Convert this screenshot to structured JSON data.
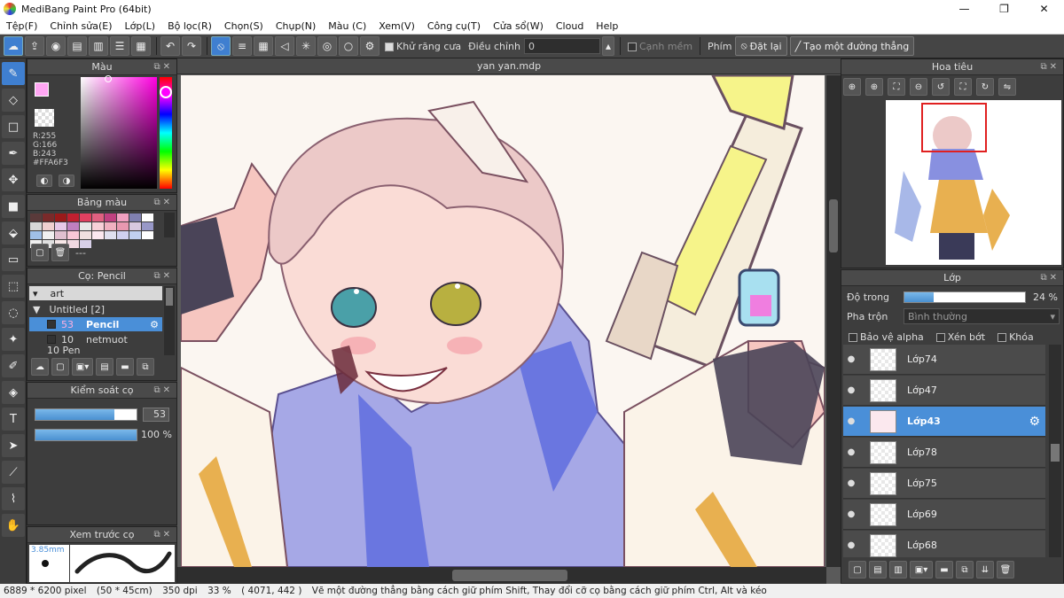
{
  "window": {
    "title": "MediBang Paint Pro (64bit)",
    "min": "—",
    "max": "❐",
    "close": "✕"
  },
  "menu": [
    "Tệp(F)",
    "Chỉnh sửa(E)",
    "Lớp(L)",
    "Bộ lọc(R)",
    "Chọn(S)",
    "Chụp(N)",
    "Màu (C)",
    "Xem(V)",
    "Công cụ(T)",
    "Cửa sổ(W)",
    "Cloud",
    "Help"
  ],
  "toolbar": {
    "antialias_label": "Khử răng cưa",
    "adjust_label": "Điều chỉnh",
    "adjust_value": "0",
    "soften_label": "Cạnh mềm",
    "key_label": "Phím",
    "reset_label": "Đặt lại",
    "straight_label": "Tạo một đường thẳng"
  },
  "color_panel": {
    "title": "Màu",
    "r": "R:255",
    "g": "G:166",
    "b": "B:243",
    "hex": "#FFA6F3",
    "current_color": "#FFA6F3"
  },
  "palette_panel": {
    "title": "Bảng màu",
    "name": "---",
    "swatches": [
      "#5a3a3a",
      "#7a2a2a",
      "#9a1a1a",
      "#c02030",
      "#e04060",
      "#e06080",
      "#c04080",
      "#f0a0c0",
      "#8080b0",
      "#ffffff",
      "#d8d8d8",
      "#f0d0d0",
      "#e8c8e8",
      "#c080c0",
      "#e8e8e8",
      "#f8d0d8",
      "#f0b0c0",
      "#e898b0",
      "#d8c8e0",
      "#9898c8",
      "#a0c0e8",
      "#f0f0f0",
      "#e0c0d0",
      "#f8c8d8",
      "#f0e0e0",
      "#fce8f0",
      "#e0e0f0",
      "#d0d0f0",
      "#c0d0f0",
      "#ffffff",
      "#f0f0f0",
      "#e0e0e0",
      "#f8e8e8",
      "#f0d8e0",
      "#d8d0e8"
    ]
  },
  "brush_panel": {
    "title": "Cọ: Pencil",
    "group_art": "art",
    "group_untitled": "Untitled [2]",
    "items": [
      {
        "size": "53",
        "name": "Pencil"
      },
      {
        "size": "10",
        "name": "netmuot"
      }
    ],
    "partial": "10 Pen"
  },
  "brush_control": {
    "title": "Kiểm soát cọ",
    "size": "53",
    "opacity": "100 %",
    "size_fill": 0.78,
    "opacity_fill": 1.0
  },
  "brush_preview": {
    "title": "Xem trước cọ",
    "size": "3.85mm"
  },
  "canvas": {
    "doc_title": "yan yan.mdp"
  },
  "navigator": {
    "title": "Hoa tiêu"
  },
  "layer_panel": {
    "title": "Lớp",
    "opacity_label": "Độ trong",
    "opacity_value": "24 %",
    "opacity_fill": 0.24,
    "blend_label": "Pha trộn",
    "blend_value": "Bình thường",
    "protect_alpha": "Bảo vệ alpha",
    "clip": "Xén bớt",
    "lock": "Khóa",
    "layers": [
      {
        "name": "Lớp74",
        "selected": false
      },
      {
        "name": "Lớp47",
        "selected": false
      },
      {
        "name": "Lớp43",
        "selected": true
      },
      {
        "name": "Lớp78",
        "selected": false
      },
      {
        "name": "Lớp75",
        "selected": false
      },
      {
        "name": "Lớp69",
        "selected": false
      },
      {
        "name": "Lớp68",
        "selected": false
      }
    ]
  },
  "status": {
    "pixels": "6889 * 6200 pixel",
    "cm": "(50 * 45cm)",
    "dpi": "350 dpi",
    "zoom": "33 %",
    "coords": "( 4071, 442 )",
    "hint": "Vẽ một đường thẳng bằng cách giữ phím Shift, Thay đổi cỡ cọ bằng cách giữ phím Ctrl, Alt và kéo"
  }
}
